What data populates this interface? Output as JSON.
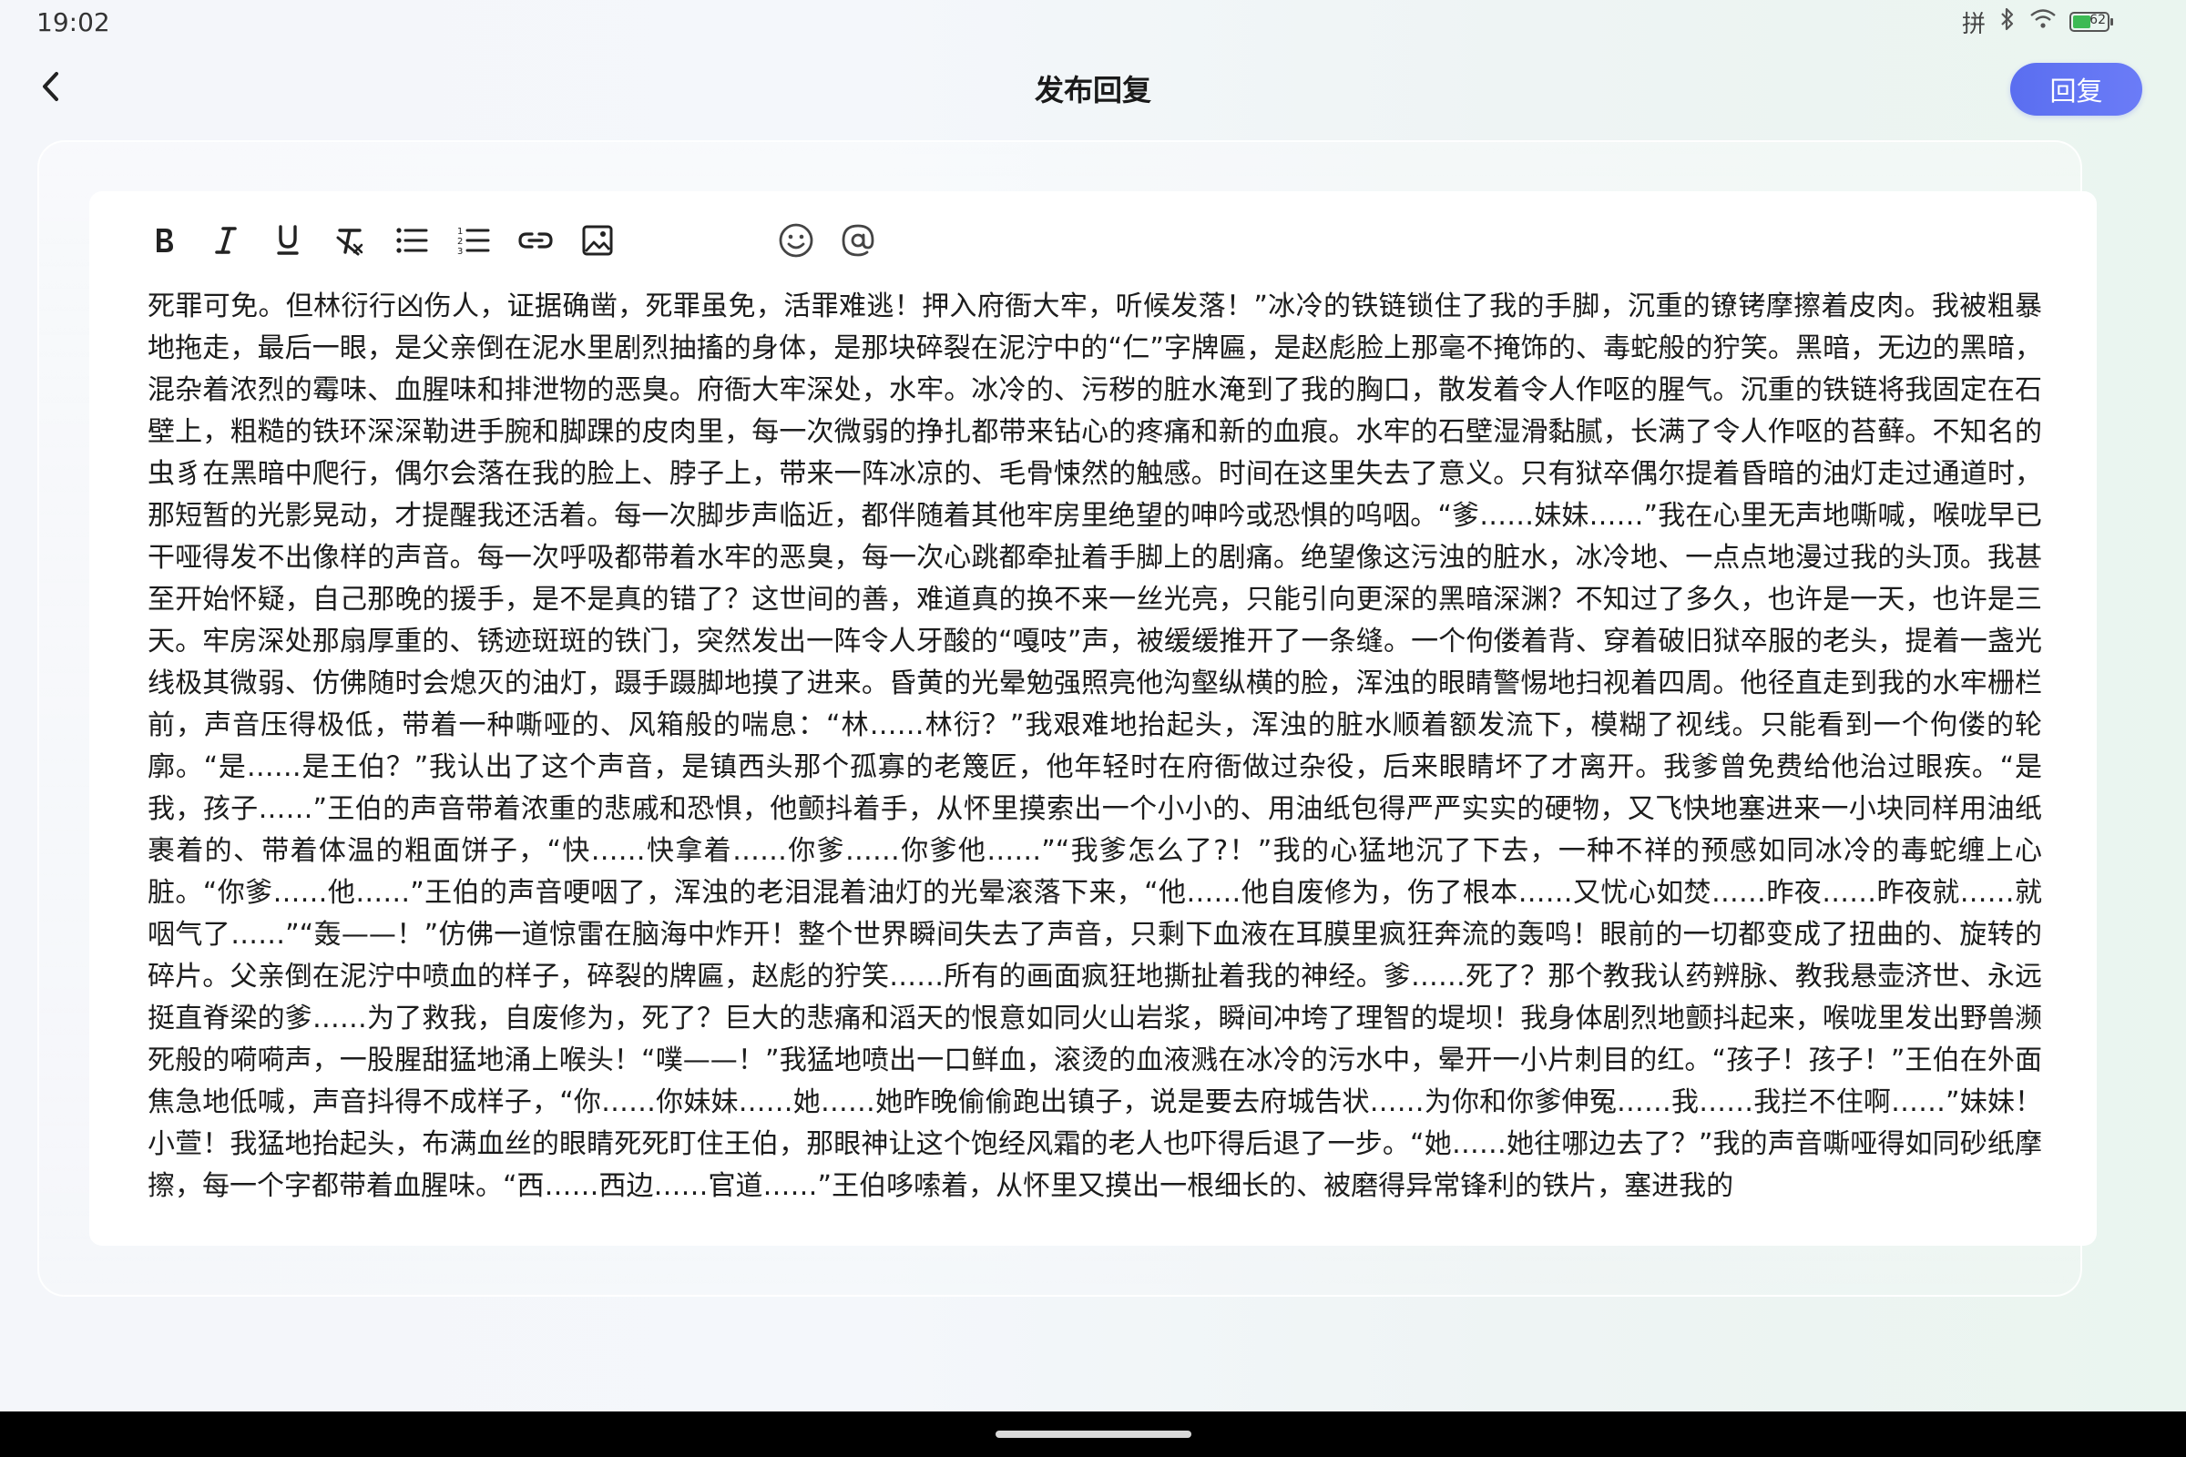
{
  "status_bar": {
    "time": "19:02",
    "ime": "拼",
    "battery_level": "62"
  },
  "header": {
    "title": "发布回复",
    "reply_label": "回复"
  },
  "toolbar": {
    "icons": [
      "bold-icon",
      "italic-icon",
      "underline-icon",
      "clear-format-icon",
      "bullet-list-icon",
      "numbered-list-icon",
      "link-icon",
      "image-icon",
      "emoji-icon",
      "mention-icon"
    ]
  },
  "editor": {
    "content": "死罪可免。但林衍行凶伤人，证据确凿，死罪虽免，活罪难逃！押入府衙大牢，听候发落！”冰冷的铁链锁住了我的手脚，沉重的镣铐摩擦着皮肉。我被粗暴地拖走，最后一眼，是父亲倒在泥水里剧烈抽搐的身体，是那块碎裂在泥泞中的“仁”字牌匾，是赵彪脸上那毫不掩饰的、毒蛇般的狞笑。黑暗，无边的黑暗，混杂着浓烈的霉味、血腥味和排泄物的恶臭。府衙大牢深处，水牢。冰冷的、污秽的脏水淹到了我的胸口，散发着令人作呕的腥气。沉重的铁链将我固定在石壁上，粗糙的铁环深深勒进手腕和脚踝的皮肉里，每一次微弱的挣扎都带来钻心的疼痛和新的血痕。水牢的石壁湿滑黏腻，长满了令人作呕的苔藓。不知名的虫豸在黑暗中爬行，偶尔会落在我的脸上、脖子上，带来一阵冰凉的、毛骨悚然的触感。时间在这里失去了意义。只有狱卒偶尔提着昏暗的油灯走过通道时，那短暂的光影晃动，才提醒我还活着。每一次脚步声临近，都伴随着其他牢房里绝望的呻吟或恐惧的呜咽。“爹……妹妹……”我在心里无声地嘶喊，喉咙早已干哑得发不出像样的声音。每一次呼吸都带着水牢的恶臭，每一次心跳都牵扯着手脚上的剧痛。绝望像这污浊的脏水，冰冷地、一点点地漫过我的头顶。我甚至开始怀疑，自己那晚的援手，是不是真的错了？这世间的善，难道真的换不来一丝光亮，只能引向更深的黑暗深渊？不知过了多久，也许是一天，也许是三天。牢房深处那扇厚重的、锈迹斑斑的铁门，突然发出一阵令人牙酸的“嘎吱”声，被缓缓推开了一条缝。一个佝偻着背、穿着破旧狱卒服的老头，提着一盏光线极其微弱、仿佛随时会熄灭的油灯，蹑手蹑脚地摸了进来。昏黄的光晕勉强照亮他沟壑纵横的脸，浑浊的眼睛警惕地扫视着四周。他径直走到我的水牢栅栏前，声音压得极低，带着一种嘶哑的、风箱般的喘息：“林……林衍？”我艰难地抬起头，浑浊的脏水顺着额发流下，模糊了视线。只能看到一个佝偻的轮廓。“是……是王伯？”我认出了这个声音，是镇西头那个孤寡的老篾匠，他年轻时在府衙做过杂役，后来眼睛坏了才离开。我爹曾免费给他治过眼疾。“是我，孩子……”王伯的声音带着浓重的悲戚和恐惧，他颤抖着手，从怀里摸索出一个小小的、用油纸包得严严实实的硬物，又飞快地塞进来一小块同样用油纸裹着的、带着体温的粗面饼子，“快……快拿着……你爹……你爹他……”“我爹怎么了?！”我的心猛地沉了下去，一种不祥的预感如同冰冷的毒蛇缠上心脏。“你爹……他……”王伯的声音哽咽了，浑浊的老泪混着油灯的光晕滚落下来，“他……他自废修为，伤了根本……又忧心如焚……昨夜……昨夜就……就咽气了……”“轰——！”仿佛一道惊雷在脑海中炸开！整个世界瞬间失去了声音，只剩下血液在耳膜里疯狂奔流的轰鸣！眼前的一切都变成了扭曲的、旋转的碎片。父亲倒在泥泞中喷血的样子，碎裂的牌匾，赵彪的狞笑……所有的画面疯狂地撕扯着我的神经。爹……死了？那个教我认药辨脉、教我悬壶济世、永远挺直脊梁的爹……为了救我，自废修为，死了？巨大的悲痛和滔天的恨意如同火山岩浆，瞬间冲垮了理智的堤坝！我身体剧烈地颤抖起来，喉咙里发出野兽濒死般的嗬嗬声，一股腥甜猛地涌上喉头！“噗——！”我猛地喷出一口鲜血，滚烫的血液溅在冰冷的污水中，晕开一小片刺目的红。“孩子！孩子！”王伯在外面焦急地低喊，声音抖得不成样子，“你……你妹妹……她……她昨晚偷偷跑出镇子，说是要去府城告状……为你和你爹伸冤……我……我拦不住啊……”妹妹！小萱！我猛地抬起头，布满血丝的眼睛死死盯住王伯，那眼神让这个饱经风霜的老人也吓得后退了一步。“她……她往哪边去了？”我的声音嘶哑得如同砂纸摩擦，每一个字都带着血腥味。“西……西边……官道……”王伯哆嗦着，从怀里又摸出一根细长的、被磨得异常锋利的铁片，塞进我的"
  },
  "colors": {
    "accent": "#5a6ef0",
    "background": "#f4f6fa"
  }
}
